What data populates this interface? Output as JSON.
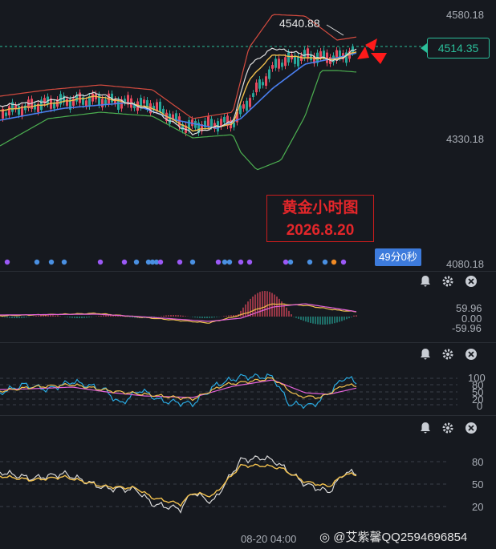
{
  "main_chart": {
    "price_labels": {
      "top": "4580.18",
      "mid": "4330.18",
      "bottom": "4080.18"
    },
    "current_price": "4514.35",
    "high_marker": "4540.88",
    "note_line1": "黄金小时图",
    "note_line2": "2026.8.20",
    "countdown": "49分0秒"
  },
  "macd_pane": {
    "labels": [
      "59.96",
      "0.00",
      "-59.96"
    ]
  },
  "kdj_pane": {
    "labels": [
      "100",
      "80",
      "50",
      "20",
      "0"
    ]
  },
  "rsi_pane": {
    "labels": [
      "80",
      "50",
      "20"
    ]
  },
  "time_axis": {
    "label": "08-20 04:00"
  },
  "watermark": "艾紫馨QQ2594696854",
  "colors": {
    "up": "#e84a5f",
    "down": "#26a69a",
    "boll_upper": "#d44b3f",
    "boll_lower": "#4caf50",
    "ma_white": "#e0e0e0",
    "ma_yellow": "#f2c14e",
    "ma_blue": "#4a7ff0",
    "background": "#16191f"
  },
  "icons": [
    "bell-icon",
    "gear-icon",
    "close-icon"
  ]
}
